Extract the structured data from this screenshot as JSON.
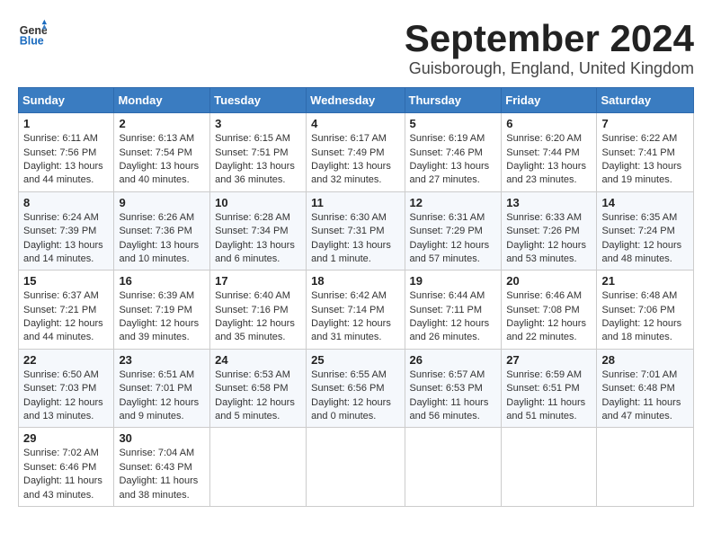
{
  "header": {
    "logo_general": "General",
    "logo_blue": "Blue",
    "month_title": "September 2024",
    "subtitle": "Guisborough, England, United Kingdom"
  },
  "weekdays": [
    "Sunday",
    "Monday",
    "Tuesday",
    "Wednesday",
    "Thursday",
    "Friday",
    "Saturday"
  ],
  "weeks": [
    [
      {
        "day": "1",
        "info": "Sunrise: 6:11 AM\nSunset: 7:56 PM\nDaylight: 13 hours\nand 44 minutes."
      },
      {
        "day": "2",
        "info": "Sunrise: 6:13 AM\nSunset: 7:54 PM\nDaylight: 13 hours\nand 40 minutes."
      },
      {
        "day": "3",
        "info": "Sunrise: 6:15 AM\nSunset: 7:51 PM\nDaylight: 13 hours\nand 36 minutes."
      },
      {
        "day": "4",
        "info": "Sunrise: 6:17 AM\nSunset: 7:49 PM\nDaylight: 13 hours\nand 32 minutes."
      },
      {
        "day": "5",
        "info": "Sunrise: 6:19 AM\nSunset: 7:46 PM\nDaylight: 13 hours\nand 27 minutes."
      },
      {
        "day": "6",
        "info": "Sunrise: 6:20 AM\nSunset: 7:44 PM\nDaylight: 13 hours\nand 23 minutes."
      },
      {
        "day": "7",
        "info": "Sunrise: 6:22 AM\nSunset: 7:41 PM\nDaylight: 13 hours\nand 19 minutes."
      }
    ],
    [
      {
        "day": "8",
        "info": "Sunrise: 6:24 AM\nSunset: 7:39 PM\nDaylight: 13 hours\nand 14 minutes."
      },
      {
        "day": "9",
        "info": "Sunrise: 6:26 AM\nSunset: 7:36 PM\nDaylight: 13 hours\nand 10 minutes."
      },
      {
        "day": "10",
        "info": "Sunrise: 6:28 AM\nSunset: 7:34 PM\nDaylight: 13 hours\nand 6 minutes."
      },
      {
        "day": "11",
        "info": "Sunrise: 6:30 AM\nSunset: 7:31 PM\nDaylight: 13 hours\nand 1 minute."
      },
      {
        "day": "12",
        "info": "Sunrise: 6:31 AM\nSunset: 7:29 PM\nDaylight: 12 hours\nand 57 minutes."
      },
      {
        "day": "13",
        "info": "Sunrise: 6:33 AM\nSunset: 7:26 PM\nDaylight: 12 hours\nand 53 minutes."
      },
      {
        "day": "14",
        "info": "Sunrise: 6:35 AM\nSunset: 7:24 PM\nDaylight: 12 hours\nand 48 minutes."
      }
    ],
    [
      {
        "day": "15",
        "info": "Sunrise: 6:37 AM\nSunset: 7:21 PM\nDaylight: 12 hours\nand 44 minutes."
      },
      {
        "day": "16",
        "info": "Sunrise: 6:39 AM\nSunset: 7:19 PM\nDaylight: 12 hours\nand 39 minutes."
      },
      {
        "day": "17",
        "info": "Sunrise: 6:40 AM\nSunset: 7:16 PM\nDaylight: 12 hours\nand 35 minutes."
      },
      {
        "day": "18",
        "info": "Sunrise: 6:42 AM\nSunset: 7:14 PM\nDaylight: 12 hours\nand 31 minutes."
      },
      {
        "day": "19",
        "info": "Sunrise: 6:44 AM\nSunset: 7:11 PM\nDaylight: 12 hours\nand 26 minutes."
      },
      {
        "day": "20",
        "info": "Sunrise: 6:46 AM\nSunset: 7:08 PM\nDaylight: 12 hours\nand 22 minutes."
      },
      {
        "day": "21",
        "info": "Sunrise: 6:48 AM\nSunset: 7:06 PM\nDaylight: 12 hours\nand 18 minutes."
      }
    ],
    [
      {
        "day": "22",
        "info": "Sunrise: 6:50 AM\nSunset: 7:03 PM\nDaylight: 12 hours\nand 13 minutes."
      },
      {
        "day": "23",
        "info": "Sunrise: 6:51 AM\nSunset: 7:01 PM\nDaylight: 12 hours\nand 9 minutes."
      },
      {
        "day": "24",
        "info": "Sunrise: 6:53 AM\nSunset: 6:58 PM\nDaylight: 12 hours\nand 5 minutes."
      },
      {
        "day": "25",
        "info": "Sunrise: 6:55 AM\nSunset: 6:56 PM\nDaylight: 12 hours\nand 0 minutes."
      },
      {
        "day": "26",
        "info": "Sunrise: 6:57 AM\nSunset: 6:53 PM\nDaylight: 11 hours\nand 56 minutes."
      },
      {
        "day": "27",
        "info": "Sunrise: 6:59 AM\nSunset: 6:51 PM\nDaylight: 11 hours\nand 51 minutes."
      },
      {
        "day": "28",
        "info": "Sunrise: 7:01 AM\nSunset: 6:48 PM\nDaylight: 11 hours\nand 47 minutes."
      }
    ],
    [
      {
        "day": "29",
        "info": "Sunrise: 7:02 AM\nSunset: 6:46 PM\nDaylight: 11 hours\nand 43 minutes."
      },
      {
        "day": "30",
        "info": "Sunrise: 7:04 AM\nSunset: 6:43 PM\nDaylight: 11 hours\nand 38 minutes."
      },
      {
        "day": "",
        "info": ""
      },
      {
        "day": "",
        "info": ""
      },
      {
        "day": "",
        "info": ""
      },
      {
        "day": "",
        "info": ""
      },
      {
        "day": "",
        "info": ""
      }
    ]
  ]
}
